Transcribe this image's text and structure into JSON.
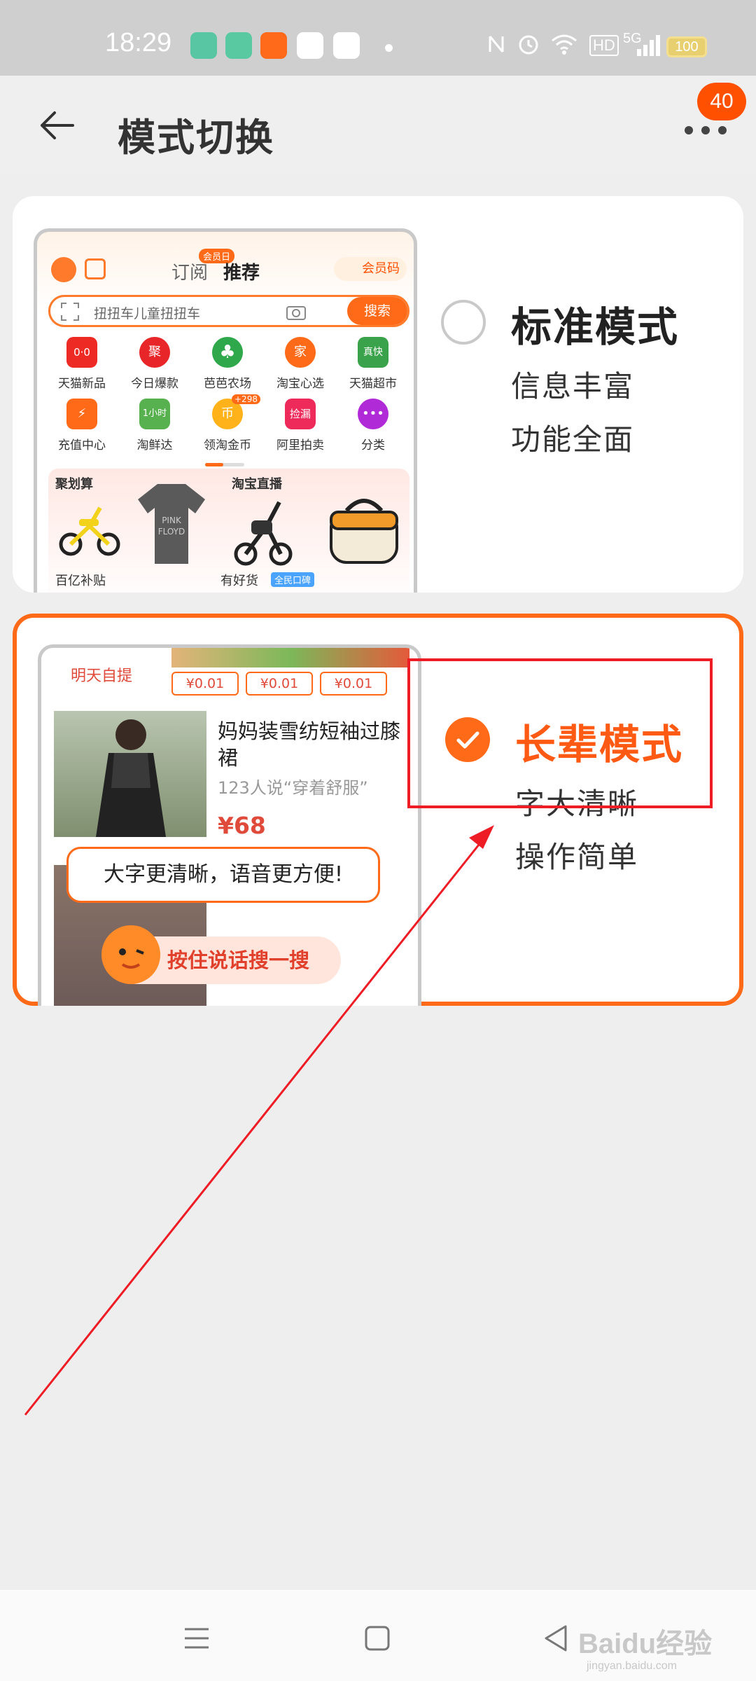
{
  "status_bar": {
    "time": "18:29",
    "network": "5G",
    "battery": "100",
    "hd_label": "HD",
    "app_icon_colors": [
      "#59c6a3",
      "#58c9a0",
      "#ff6a1a",
      "#ffffff",
      "#ffffff"
    ]
  },
  "header": {
    "title": "模式切换",
    "message_badge": "40",
    "back_icon": "arrow-left-icon",
    "more_icon": "more-dots-icon"
  },
  "modes": {
    "standard": {
      "title": "标准模式",
      "desc1": "信息丰富",
      "desc2": "功能全面",
      "selected": false,
      "preview": {
        "tab_subscribe": "订阅",
        "tab_recommend": "推荐",
        "vip_badge": "会员日",
        "member_code": "会员码",
        "search_text": "扭扭车儿童扭扭车",
        "search_button": "搜索",
        "grid": [
          {
            "label": "天猫新品",
            "icon": "0·0",
            "color": "#ee2a24"
          },
          {
            "label": "今日爆款",
            "icon": "聚",
            "color": "#e8262a"
          },
          {
            "label": "芭芭农场",
            "icon": "♣",
            "color": "#2ea84a"
          },
          {
            "label": "淘宝心选",
            "icon": "家",
            "color": "#ff6a18"
          },
          {
            "label": "天猫超市",
            "icon": "真快",
            "color": "#3aa24a"
          },
          {
            "label": "充值中心",
            "icon": "⚡",
            "color": "#ff6a18"
          },
          {
            "label": "淘鲜达",
            "icon": "1小时",
            "color": "#56b14e"
          },
          {
            "label": "领淘金币",
            "icon": "币",
            "color": "#ffb21a"
          },
          {
            "label": "阿里拍卖",
            "icon": "捡漏",
            "color": "#ee2a5a"
          },
          {
            "label": "分类",
            "icon": "•••",
            "color": "#b02ad8"
          }
        ],
        "coin_bonus": "+298",
        "feed": {
          "juhuasuan": "聚划算",
          "taobao_live": "淘宝直播",
          "subsidy": "百亿补贴",
          "good_goods": "有好货",
          "network_tag": "全民口碑"
        }
      }
    },
    "elder": {
      "title": "长辈模式",
      "desc1": "字大清晰",
      "desc2": "操作简单",
      "selected": true,
      "preview": {
        "pickup": "明天自提",
        "prices": [
          "¥0.01",
          "¥0.01",
          "¥0.01"
        ],
        "product_name": "妈妈装雪纺短袖过膝裙",
        "product_sub": "123人说“穿着舒服”",
        "product_price": "¥68",
        "bubble": "大字更清晰，语音更方便!",
        "voice_button": "按住说话搜一搜"
      }
    }
  },
  "nav_bar": {
    "menu_icon": "menu-icon",
    "home_icon": "square-home-icon",
    "back_icon": "triangle-back-icon"
  },
  "watermark": {
    "brand": "Baidu经验",
    "url": "jingyan.baidu.com"
  },
  "annotation": {
    "box_color": "#ee1c24",
    "arrow_color": "#ee1c24"
  }
}
